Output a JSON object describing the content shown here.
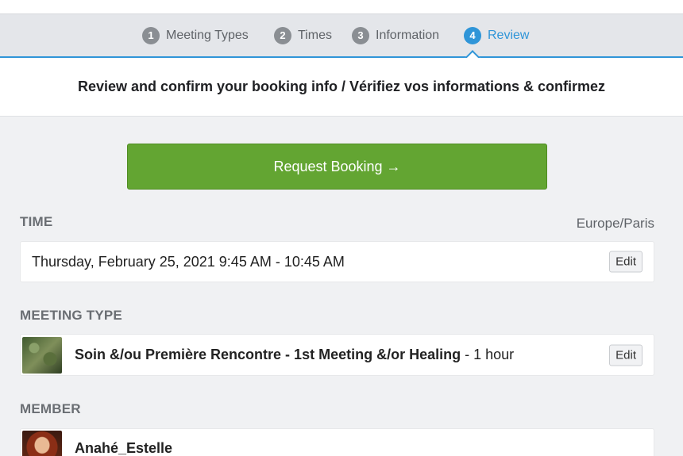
{
  "steps": [
    {
      "num": "1",
      "label": "Meeting Types"
    },
    {
      "num": "2",
      "label": "Times"
    },
    {
      "num": "3",
      "label": "Information"
    },
    {
      "num": "4",
      "label": "Review"
    }
  ],
  "active_step": "Review",
  "heading": "Review and confirm your booking info / Vérifiez vos informations & confirmez",
  "request_button": "Request Booking →",
  "time": {
    "label": "TIME",
    "timezone": "Europe/Paris",
    "value": "Thursday, February 25, 2021 9:45 AM - 10:45 AM",
    "edit_label": "Edit"
  },
  "meeting_type": {
    "label": "MEETING TYPE",
    "name": "Soin &/ou Première Rencontre - 1st Meeting &/or Healing",
    "duration": " - 1 hour",
    "edit_label": "Edit"
  },
  "member": {
    "label": "MEMBER",
    "name": "Anahé_Estelle"
  },
  "colors": {
    "accent": "#2f95d8",
    "primary_button": "#63a532"
  }
}
